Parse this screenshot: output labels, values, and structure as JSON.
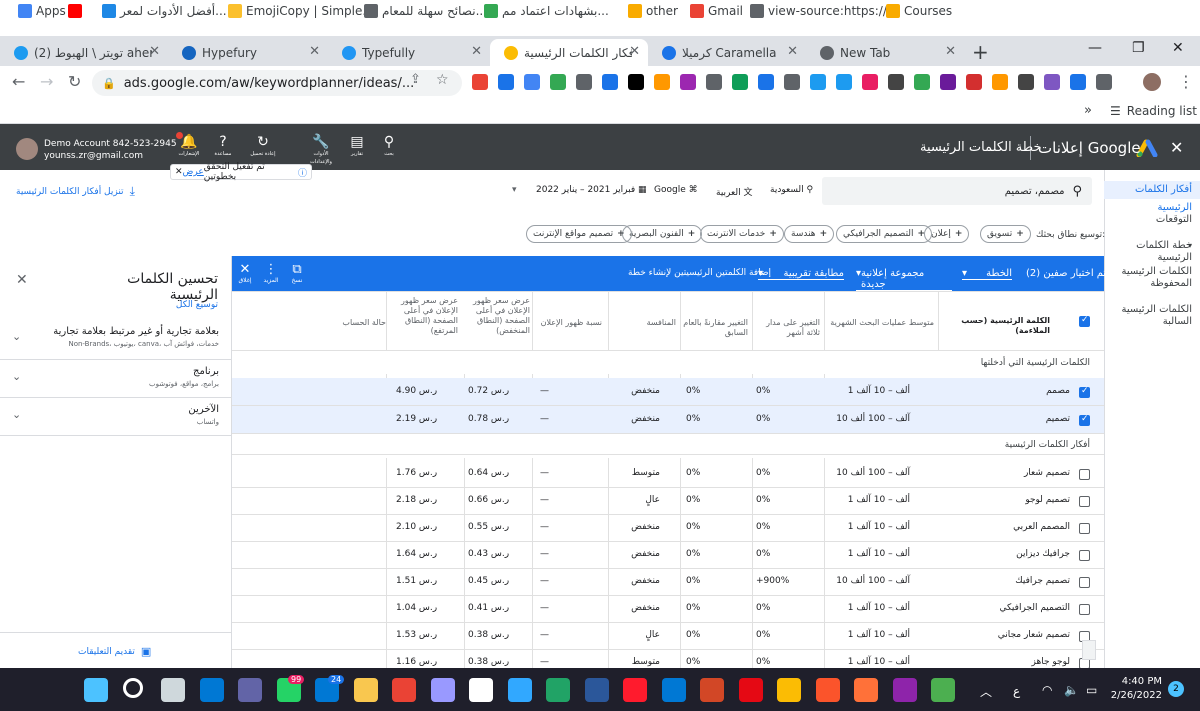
{
  "browser": {
    "tabs": [
      {
        "label": "(2) تويتر \\ الهبوط aher)",
        "color": "#1d9bf0"
      },
      {
        "label": "Hypefury",
        "color": "#1565c0"
      },
      {
        "label": "Typefully",
        "color": "#2196f3"
      },
      {
        "label": "أفكار الكلمات الرئيسية -",
        "color": "#fbbc04",
        "active": true
      },
      {
        "label": "كرميلا Caramella",
        "color": "#1a73e8"
      },
      {
        "label": "New Tab",
        "color": "#5f6368"
      }
    ],
    "new_tab": "+",
    "url": "ads.google.com/aw/keywordplanner/ideas/...",
    "window_controls": {
      "minimize": "—",
      "restore": "❐",
      "close": "✕"
    },
    "bookmarks": [
      {
        "label": "Apps",
        "color": "#4285f4"
      },
      {
        "label": "",
        "color": "#ff0000"
      },
      {
        "label": "أفضل الأدوات لمعر...",
        "color": "#1e88e5"
      },
      {
        "label": "EmojiCopy | Simple...",
        "color": "#fbc02d"
      },
      {
        "label": "نصائح سهلة للمعام...",
        "color": "#5f6368"
      },
      {
        "label": "بشهادات اعتماد مم...",
        "color": "#34a853"
      },
      {
        "label": "other",
        "color": "#f9ab00"
      },
      {
        "label": "Gmail",
        "color": "#ea4335"
      },
      {
        "label": "view-source:https://...",
        "color": "#5f6368"
      },
      {
        "label": "Courses",
        "color": "#f9ab00"
      }
    ],
    "bookmarks_more": "»",
    "reading_list": "Reading list"
  },
  "ads": {
    "title": "خطة الكلمات الرئيسية",
    "brand": "إعلانات Google",
    "account_name": "Demo Account 842-523-2945",
    "account_email": "younss.zr@gmail.com",
    "tools": [
      {
        "label": "بحث",
        "icon": "search-icon"
      },
      {
        "label": "تقارير",
        "icon": "reports-icon"
      },
      {
        "label": "الأدوات والإعدادات",
        "icon": "wrench-icon"
      },
      {
        "label": "إعادة تحميل",
        "icon": "refresh-icon"
      },
      {
        "label": "مساعدة",
        "icon": "help-icon"
      },
      {
        "label": "الإشعارات",
        "icon": "bell-icon"
      }
    ],
    "toast": {
      "text": "تم تفعيل التحقق بخطوتين",
      "link": "عرض",
      "close": "✕"
    }
  },
  "nav": {
    "items": [
      {
        "label": "أفكار الكلمات الرئيسية",
        "active": true
      },
      {
        "label": "التوقعات"
      },
      {
        "label": "خطة الكلمات الرئيسية"
      },
      {
        "label": "الكلمات الرئيسية المحفوظة"
      },
      {
        "label": "الكلمات الرئيسية السالبة"
      }
    ]
  },
  "search": {
    "value": "مصمم، تصميم"
  },
  "filters": {
    "location": "السعودية",
    "language": "العربية",
    "network": "Google",
    "date_range": "فبراير 2021 – يناير 2022",
    "download": "تنزيل أفكار الكلمات الرئيسية"
  },
  "refine_label": "توسيع نطاق بحثك:",
  "chips": [
    "تسويق",
    "إعلان",
    "التصميم الجرافيكي",
    "هندسة",
    "خدمات الانترنت",
    "الفنون البصرية",
    "تصميم مواقع الإنترنت"
  ],
  "bluebar": {
    "selected": "تم اختيار صفين (2)",
    "plan_label": "الخطة",
    "adgroup_label": "مجموعة إعلانية جديدة",
    "match_label": "مطابقة تقريبية",
    "add_text": "إضافة الكلمتين الرئيسيتين لإنشاء خطة",
    "copy_label": "نسخ",
    "more_label": "المزيد",
    "close_label": "إغلاق"
  },
  "panel": {
    "title": "تحسين الكلمات الرئيسية",
    "expand_all": "توسيع الكل",
    "groups": [
      {
        "title": "بعلامة تجارية أو غير مرتبط بعلامة تجارية",
        "subtitle": "Non-Brands، يوتيوب، canva، خدمات، فوائش آب"
      },
      {
        "title": "برنامج",
        "subtitle": "برامج، مواقع، فوتوشوب"
      },
      {
        "title": "الآخرين",
        "subtitle": "واتساب"
      }
    ],
    "feedback": "تقديم التعليقات"
  },
  "table": {
    "headers": {
      "keyword": "الكلمة الرئيسية (حسب الملاءمة)",
      "avg_searches": "متوسط عمليات البحث الشهرية",
      "three_month": "التغيير على مدار ثلاثة أشهر",
      "yoy": "التغيير مقارنةً بالعام السابق",
      "competition": "المنافسة",
      "impression_share": "نسبة ظهور الإعلان",
      "bid_low": "عرض سعر ظهور الإعلان في أعلى الصفحة (النطاق المنخفض)",
      "bid_high": "عرض سعر ظهور الإعلان في أعلى الصفحة (النطاق المرتفع)",
      "account_status": "حالة الحساب"
    },
    "section_provided": "الكلمات الرئيسية التي أدخلتها",
    "section_ideas": "أفكار الكلمات الرئيسية",
    "provided_rows": [
      {
        "keyword": "مصمم",
        "avg": "1 ألف – 10 آلف",
        "three": "0%",
        "yoy": "0%",
        "comp": "منخفض",
        "share": "—",
        "low": "ر.س 0.72",
        "high": "ر.س 4.90"
      },
      {
        "keyword": "تصميم",
        "avg": "10 آلف – 100 ألف",
        "three": "0%",
        "yoy": "0%",
        "comp": "منخفض",
        "share": "—",
        "low": "ر.س 0.78",
        "high": "ر.س 2.19"
      }
    ],
    "idea_rows": [
      {
        "keyword": "تصميم شعار",
        "avg": "10 آلف – 100 ألف",
        "three": "0%",
        "yoy": "0%",
        "comp": "متوسط",
        "share": "—",
        "low": "ر.س 0.64",
        "high": "ر.س 1.76"
      },
      {
        "keyword": "تصميم لوجو",
        "avg": "1 ألف – 10 آلف",
        "three": "0%",
        "yoy": "0%",
        "comp": "عالٍ",
        "share": "—",
        "low": "ر.س 0.66",
        "high": "ر.س 2.18"
      },
      {
        "keyword": "المصمم العربي",
        "avg": "1 ألف – 10 آلف",
        "three": "0%",
        "yoy": "0%",
        "comp": "منخفض",
        "share": "—",
        "low": "ر.س 0.55",
        "high": "ر.س 2.10"
      },
      {
        "keyword": "جرافيك ديزاين",
        "avg": "1 ألف – 10 آلف",
        "three": "0%",
        "yoy": "0%",
        "comp": "منخفض",
        "share": "—",
        "low": "ر.س 0.43",
        "high": "ر.س 1.64"
      },
      {
        "keyword": "تصميم جرافيك",
        "avg": "10 آلف – 100 ألف",
        "three": "+900%",
        "yoy": "0%",
        "comp": "منخفض",
        "share": "—",
        "low": "ر.س 0.45",
        "high": "ر.س 1.51"
      },
      {
        "keyword": "التصميم الجرافيكي",
        "avg": "1 ألف – 10 آلف",
        "three": "0%",
        "yoy": "0%",
        "comp": "منخفض",
        "share": "—",
        "low": "ر.س 0.41",
        "high": "ر.س 1.04"
      },
      {
        "keyword": "تصميم شعار مجاني",
        "avg": "1 ألف – 10 آلف",
        "three": "0%",
        "yoy": "0%",
        "comp": "عالٍ",
        "share": "—",
        "low": "ر.س 0.38",
        "high": "ر.س 1.53"
      },
      {
        "keyword": "لوجو جاهز",
        "avg": "1 ألف – 10 آلف",
        "three": "0%",
        "yoy": "0%",
        "comp": "متوسط",
        "share": "—",
        "low": "ر.س 0.38",
        "high": "ر.س 1.16"
      }
    ]
  },
  "taskbar": {
    "time": "4:40 PM",
    "date": "2/26/2022",
    "lang": "ع",
    "notification_count": "2",
    "whatsapp_badge": "99",
    "mail_badge": "24",
    "apps": [
      {
        "name": "start",
        "color": "#4cc2ff"
      },
      {
        "name": "search",
        "color": "#ffffff"
      },
      {
        "name": "task-view",
        "color": "#cfd8dc"
      },
      {
        "name": "widgets",
        "color": "#0078d4"
      },
      {
        "name": "teams",
        "color": "#6264a7"
      },
      {
        "name": "whatsapp",
        "color": "#25d366"
      },
      {
        "name": "mail",
        "color": "#0078d4"
      },
      {
        "name": "explorer",
        "color": "#f9c74f"
      },
      {
        "name": "chrome",
        "color": "#ea4335"
      },
      {
        "name": "premiere",
        "color": "#9999ff"
      },
      {
        "name": "notion",
        "color": "#ffffff"
      },
      {
        "name": "photoshop",
        "color": "#31a8ff"
      },
      {
        "name": "excel",
        "color": "#21a366"
      },
      {
        "name": "word",
        "color": "#2b579a"
      },
      {
        "name": "opera",
        "color": "#ff1b2d"
      },
      {
        "name": "outlook",
        "color": "#0078d4"
      },
      {
        "name": "powerpoint",
        "color": "#d24726"
      },
      {
        "name": "netflix",
        "color": "#e50914"
      },
      {
        "name": "google-ads",
        "color": "#fbbc04"
      },
      {
        "name": "brave",
        "color": "#fb542b"
      },
      {
        "name": "firefox",
        "color": "#ff7139"
      },
      {
        "name": "winrar",
        "color": "#8e24aa"
      },
      {
        "name": "maps",
        "color": "#4caf50"
      }
    ]
  },
  "colors": {
    "accent": "#1a73e8",
    "header": "#3c4043",
    "taskbar": "#1f1f2b"
  }
}
